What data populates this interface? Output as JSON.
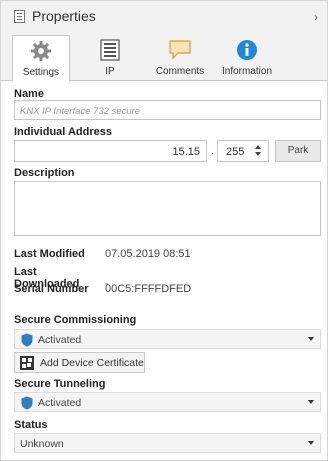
{
  "title": "Properties",
  "collapse_glyph": "›",
  "tabs": [
    {
      "label": "Settings",
      "icon": "gear-icon",
      "active": true
    },
    {
      "label": "IP",
      "icon": "ip-list-icon",
      "active": false
    },
    {
      "label": "Comments",
      "icon": "comment-icon",
      "active": false
    },
    {
      "label": "Information",
      "icon": "info-icon",
      "active": false
    }
  ],
  "name": {
    "label": "Name",
    "placeholder": "KNX IP Interface 732 secure"
  },
  "individual_address": {
    "label": "Individual Address",
    "prefix": "15.15",
    "separator": ".",
    "device": "255",
    "park_label": "Park"
  },
  "description": {
    "label": "Description",
    "value": ""
  },
  "info": {
    "last_modified_label": "Last Modified",
    "last_modified_value": "07.05.2019 08:51",
    "last_downloaded_label": "Last Downloaded",
    "last_downloaded_value": "-",
    "serial_label": "Serial Number",
    "serial_value": "00C5:FFFFDFED"
  },
  "secure_commissioning": {
    "label": "Secure Commissioning",
    "value": "Activated"
  },
  "add_cert_label": "Add Device Certificate",
  "secure_tunneling": {
    "label": "Secure Tunneling",
    "value": "Activated"
  },
  "status": {
    "label": "Status",
    "value": "Unknown"
  },
  "colors": {
    "shield": "#2c7fc4",
    "info": "#1e88d8",
    "comment": "#f0b050"
  }
}
